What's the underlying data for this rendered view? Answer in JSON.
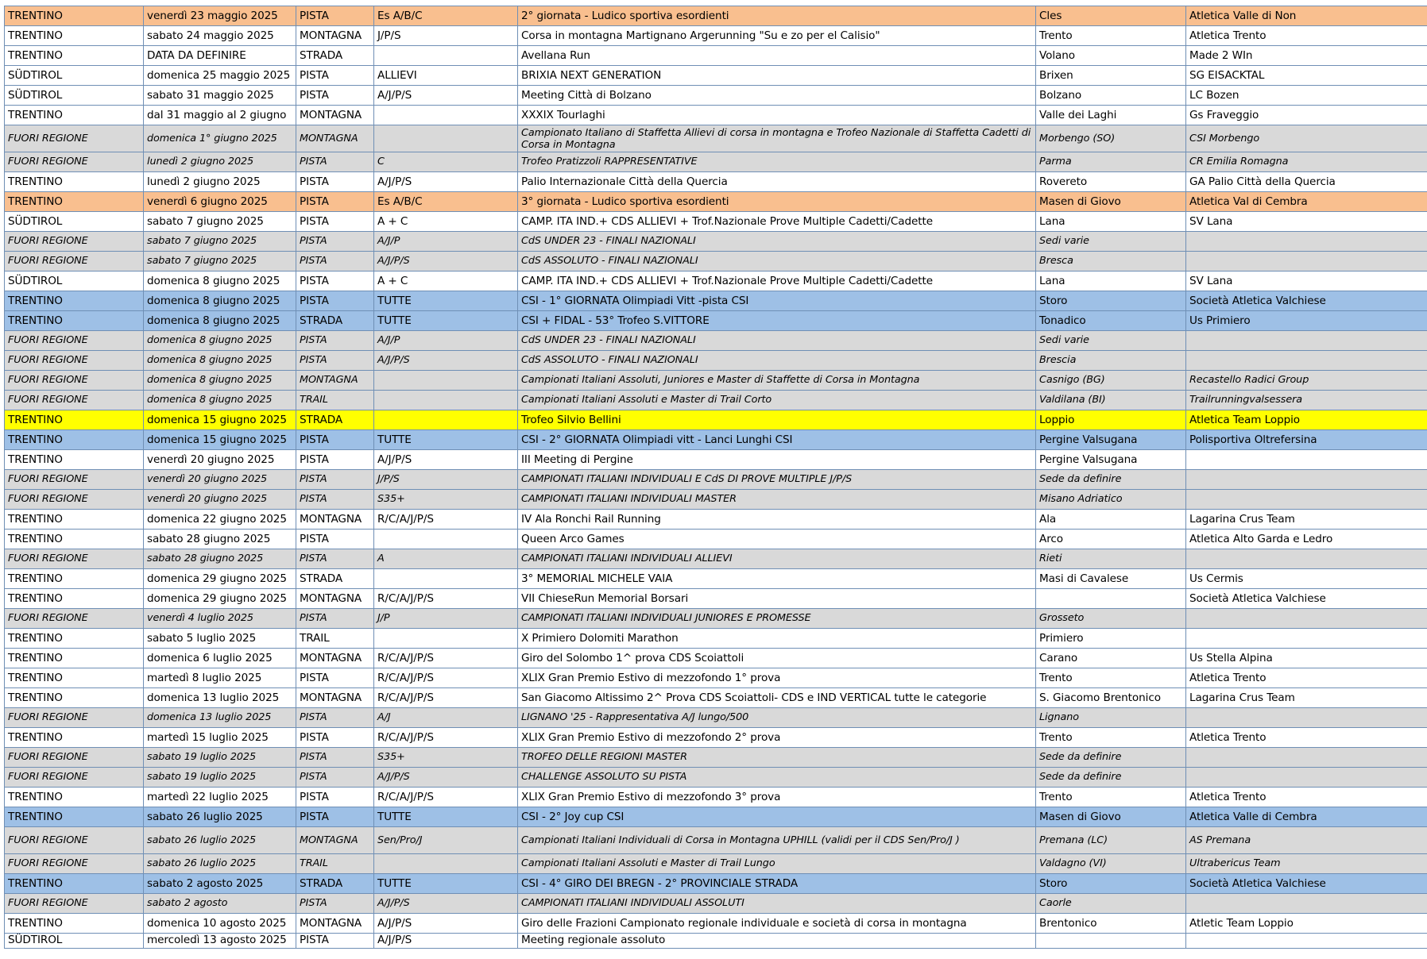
{
  "colors": {
    "orange": "#f9bf8f",
    "blue": "#9ec0e6",
    "yellow": "#ffff00",
    "gray": "#d9d9d9",
    "white": "#ffffff"
  },
  "rows": [
    {
      "style": "orange",
      "cells": [
        "TRENTINO",
        "venerdì 23 maggio 2025",
        "PISTA",
        "Es A/B/C",
        "2° giornata - Ludico sportiva esordienti",
        "Cles",
        "Atletica Valle di Non"
      ]
    },
    {
      "style": "white",
      "cells": [
        "TRENTINO",
        "sabato 24 maggio 2025",
        "MONTAGNA",
        "J/P/S",
        "Corsa in montagna Martignano Argerunning \"Su e zo per el Calisio\"",
        "Trento",
        "Atletica Trento"
      ]
    },
    {
      "style": "white",
      "cells": [
        "TRENTINO",
        "DATA DA DEFINIRE",
        "STRADA",
        "",
        "Avellana Run",
        "Volano",
        "Made 2 WIn"
      ]
    },
    {
      "style": "white",
      "cells": [
        "SÜDTIROL",
        "domenica 25 maggio 2025",
        "PISTA",
        "ALLIEVI",
        "BRIXIA NEXT GENERATION",
        "Brixen",
        "SG EISACKTAL"
      ]
    },
    {
      "style": "white",
      "cells": [
        "SÜDTIROL",
        "sabato 31 maggio 2025",
        "PISTA",
        "A/J/P/S",
        "Meeting Città di Bolzano",
        "Bolzano",
        "LC Bozen"
      ]
    },
    {
      "style": "white",
      "cells": [
        "TRENTINO",
        "dal 31 maggio al 2 giugno",
        "MONTAGNA",
        "",
        "XXXIX Tourlaghi",
        "Valle dei Laghi",
        "Gs Fraveggio"
      ]
    },
    {
      "style": "gray",
      "tall": true,
      "cells": [
        "FUORI REGIONE",
        "domenica 1° giugno 2025",
        "MONTAGNA",
        "",
        "Campionato Italiano di Staffetta Allievi di corsa in montagna e Trofeo Nazionale di Staffetta Cadetti di Corsa in Montagna",
        "Morbengo (SO)",
        "CSI Morbengo"
      ]
    },
    {
      "style": "gray",
      "cells": [
        "FUORI REGIONE",
        "lunedì 2 giugno 2025",
        "PISTA",
        "C",
        "Trofeo Pratizzoli RAPPRESENTATIVE",
        "Parma",
        "CR Emilia Romagna"
      ]
    },
    {
      "style": "white",
      "cells": [
        "TRENTINO",
        "lunedì 2 giugno 2025",
        "PISTA",
        "A/J/P/S",
        "Palio Internazionale Città della Quercia",
        "Rovereto",
        "GA Palio Città della Quercia"
      ]
    },
    {
      "style": "orange",
      "cells": [
        "TRENTINO",
        "venerdì 6 giugno 2025",
        "PISTA",
        "Es A/B/C",
        "3° giornata - Ludico sportiva esordienti",
        "Masen di Giovo",
        "Atletica Val di Cembra"
      ]
    },
    {
      "style": "white",
      "cells": [
        "SÜDTIROL",
        "sabato 7 giugno 2025",
        "PISTA",
        "A + C",
        "CAMP. ITA IND.+ CDS ALLIEVI + Trof.Nazionale Prove Multiple Cadetti/Cadette",
        "Lana",
        "SV Lana"
      ]
    },
    {
      "style": "gray",
      "cells": [
        "FUORI REGIONE",
        "sabato 7 giugno 2025",
        "PISTA",
        "A/J/P",
        "CdS UNDER 23 - FINALI NAZIONALI",
        "Sedi varie",
        ""
      ]
    },
    {
      "style": "gray",
      "cells": [
        "FUORI REGIONE",
        "sabato 7 giugno 2025",
        "PISTA",
        "A/J/P/S",
        "CdS ASSOLUTO - FINALI NAZIONALI",
        "Bresca",
        ""
      ]
    },
    {
      "style": "white",
      "cells": [
        "SÜDTIROL",
        "domenica 8 giugno 2025",
        "PISTA",
        "A + C",
        "CAMP. ITA IND.+ CDS ALLIEVI + Trof.Nazionale Prove Multiple Cadetti/Cadette",
        "Lana",
        "SV Lana"
      ]
    },
    {
      "style": "blue",
      "cells": [
        "TRENTINO",
        "domenica 8 giugno 2025",
        "PISTA",
        "TUTTE",
        "CSI - 1° GIORNATA Olimpiadi Vitt -pista CSI",
        "Storo",
        "Società Atletica Valchiese"
      ]
    },
    {
      "style": "blue",
      "cells": [
        "TRENTINO",
        "domenica 8 giugno 2025",
        "STRADA",
        "TUTTE",
        "CSI + FIDAL - 53° Trofeo S.VITTORE",
        "Tonadico",
        "Us Primiero"
      ]
    },
    {
      "style": "gray",
      "cells": [
        "FUORI REGIONE",
        "domenica 8 giugno 2025",
        "PISTA",
        "A/J/P",
        "CdS UNDER 23 - FINALI NAZIONALI",
        "Sedi varie",
        ""
      ]
    },
    {
      "style": "gray",
      "cells": [
        "FUORI REGIONE",
        "domenica 8 giugno 2025",
        "PISTA",
        "A/J/P/S",
        "CdS ASSOLUTO - FINALI NAZIONALI",
        "Brescia",
        ""
      ]
    },
    {
      "style": "gray",
      "cells": [
        "FUORI REGIONE",
        "domenica 8 giugno 2025",
        "MONTAGNA",
        "",
        "Campionati Italiani Assoluti, Juniores e Master di Staffette di Corsa in Montagna",
        "Casnigo (BG)",
        "Recastello Radici Group"
      ]
    },
    {
      "style": "gray",
      "cells": [
        "FUORI REGIONE",
        "domenica 8 giugno 2025",
        "TRAIL",
        "",
        "Campionati Italiani Assoluti e Master di Trail Corto",
        "Valdilana (BI)",
        "Trailrunningvalsessera"
      ]
    },
    {
      "style": "yellow",
      "cells": [
        "TRENTINO",
        "domenica 15 giugno 2025",
        "STRADA",
        "",
        "Trofeo Silvio Bellini",
        "Loppio",
        "Atletica Team Loppio"
      ]
    },
    {
      "style": "blue",
      "cells": [
        "TRENTINO",
        "domenica 15 giugno 2025",
        "PISTA",
        "TUTTE",
        "CSI - 2° GIORNATA Olimpiadi vitt - Lanci Lunghi CSI",
        "Pergine Valsugana",
        "Polisportiva Oltrefersina"
      ]
    },
    {
      "style": "white",
      "cells": [
        "TRENTINO",
        "venerdì 20 giugno 2025",
        "PISTA",
        "A/J/P/S",
        "III Meeting di Pergine",
        "Pergine Valsugana",
        ""
      ]
    },
    {
      "style": "gray",
      "cells": [
        "FUORI REGIONE",
        "venerdì 20 giugno 2025",
        "PISTA",
        "J/P/S",
        "CAMPIONATI ITALIANI INDIVIDUALI E CdS DI PROVE MULTIPLE J/P/S",
        "Sede da definire",
        ""
      ]
    },
    {
      "style": "gray",
      "cells": [
        "FUORI REGIONE",
        "venerdì 20 giugno 2025",
        "PISTA",
        "S35+",
        "CAMPIONATI ITALIANI INDIVIDUALI MASTER",
        "Misano Adriatico",
        ""
      ]
    },
    {
      "style": "white",
      "cells": [
        "TRENTINO",
        "domenica 22 giugno 2025",
        "MONTAGNA",
        "R/C/A/J/P/S",
        "IV Ala Ronchi Rail Running",
        "Ala",
        "Lagarina Crus Team"
      ]
    },
    {
      "style": "white",
      "cells": [
        "TRENTINO",
        "sabato 28 giugno 2025",
        "PISTA",
        "",
        "Queen Arco Games",
        "Arco",
        "Atletica Alto Garda e Ledro"
      ]
    },
    {
      "style": "gray",
      "cells": [
        "FUORI REGIONE",
        "sabato 28 giugno 2025",
        "PISTA",
        "A",
        "CAMPIONATI ITALIANI INDIVIDUALI ALLIEVI",
        "Rieti",
        ""
      ]
    },
    {
      "style": "white",
      "cells": [
        "TRENTINO",
        "domenica 29 giugno 2025",
        "STRADA",
        "",
        "3° MEMORIAL MICHELE VAIA",
        "Masi di Cavalese",
        "Us Cermis"
      ]
    },
    {
      "style": "white",
      "cells": [
        "TRENTINO",
        "domenica 29 giugno 2025",
        "MONTAGNA",
        "R/C/A/J/P/S",
        "VII ChieseRun Memorial Borsari",
        "",
        "Società Atletica Valchiese"
      ]
    },
    {
      "style": "gray",
      "cells": [
        "FUORI REGIONE",
        "venerdì 4 luglio 2025",
        "PISTA",
        "J/P",
        "CAMPIONATI ITALIANI INDIVIDUALI JUNIORES E PROMESSE",
        "Grosseto",
        ""
      ]
    },
    {
      "style": "white",
      "cells": [
        "TRENTINO",
        "sabato 5 luglio 2025",
        "TRAIL",
        "",
        "X Primiero Dolomiti Marathon",
        "Primiero",
        ""
      ]
    },
    {
      "style": "white",
      "cells": [
        "TRENTINO",
        "domenica 6 luglio 2025",
        "MONTAGNA",
        "R/C/A/J/P/S",
        "Giro del Solombo 1^ prova CDS Scoiattoli",
        "Carano",
        "Us Stella Alpina"
      ]
    },
    {
      "style": "white",
      "cells": [
        "TRENTINO",
        "martedì 8 luglio 2025",
        "PISTA",
        "R/C/A/J/P/S",
        "XLIX Gran Premio Estivo  di mezzofondo 1° prova",
        "Trento",
        "Atletica Trento"
      ]
    },
    {
      "style": "white",
      "cells": [
        "TRENTINO",
        "domenica 13 luglio 2025",
        "MONTAGNA",
        "R/C/A/J/P/S",
        "San Giacomo Altissimo 2^ Prova CDS Scoiattoli- CDS e IND VERTICAL tutte le categorie",
        "S. Giacomo Brentonico",
        "Lagarina Crus Team"
      ]
    },
    {
      "style": "gray",
      "cells": [
        "FUORI REGIONE",
        "domenica 13 luglio 2025",
        "PISTA",
        "A/J",
        "LIGNANO '25 - Rappresentativa A/J lungo/500",
        "Lignano",
        ""
      ]
    },
    {
      "style": "white",
      "cells": [
        "TRENTINO",
        "martedì 15 luglio 2025",
        "PISTA",
        "R/C/A/J/P/S",
        "XLIX Gran Premio Estivo  di mezzofondo 2° prova",
        "Trento",
        "Atletica Trento"
      ]
    },
    {
      "style": "gray",
      "cells": [
        "FUORI REGIONE",
        "sabato 19 luglio 2025",
        "PISTA",
        "S35+",
        "TROFEO DELLE REGIONI MASTER",
        "Sede da definire",
        ""
      ]
    },
    {
      "style": "gray",
      "cells": [
        "FUORI REGIONE",
        "sabato 19 luglio 2025",
        "PISTA",
        "A/J/P/S",
        "CHALLENGE ASSOLUTO SU PISTA",
        "Sede da definire",
        ""
      ]
    },
    {
      "style": "white",
      "cells": [
        "TRENTINO",
        "martedì 22 luglio 2025",
        "PISTA",
        "R/C/A/J/P/S",
        "XLIX Gran Premio Estivo  di mezzofondo 3° prova",
        "Trento",
        "Atletica Trento"
      ]
    },
    {
      "style": "blue",
      "cells": [
        "TRENTINO",
        "sabato 26 luglio 2025",
        "PISTA",
        "TUTTE",
        "CSI - 2° Joy cup CSI",
        "Masen di Giovo",
        "Atletica Valle di Cembra"
      ]
    },
    {
      "style": "gray",
      "tall": true,
      "cells": [
        "FUORI REGIONE",
        "sabato 26 luglio 2025",
        "MONTAGNA",
        "Sen/Pro/J",
        "Campionati Italiani Individuali di Corsa in Montagna UPHILL  (validi per il CDS Sen/Pro/J )",
        "Premana (LC)",
        "AS Premana"
      ]
    },
    {
      "style": "gray",
      "cells": [
        "FUORI REGIONE",
        "sabato 26 luglio 2025",
        "TRAIL",
        "",
        "Campionati Italiani Assoluti e Master di Trail Lungo",
        "Valdagno (VI)",
        "Ultrabericus Team"
      ]
    },
    {
      "style": "blue",
      "cells": [
        "TRENTINO",
        "sabato 2 agosto 2025",
        "STRADA",
        "TUTTE",
        "CSI - 4° GIRO DEI BREGN - 2° PROVINCIALE STRADA",
        "Storo",
        "Società Atletica Valchiese"
      ]
    },
    {
      "style": "gray",
      "cells": [
        "FUORI REGIONE",
        "sabato 2 agosto",
        "PISTA",
        "A/J/P/S",
        "CAMPIONATI ITALIANI INDIVIDUALI ASSOLUTI",
        "Caorle",
        ""
      ]
    },
    {
      "style": "white",
      "cells": [
        "TRENTINO",
        "domenica 10 agosto 2025",
        "MONTAGNA",
        "A/J/P/S",
        "Giro delle Frazioni Campionato regionale individuale e società di corsa in montagna",
        "Brentonico",
        "Atletic Team Loppio"
      ]
    },
    {
      "style": "white",
      "cut": true,
      "cells": [
        "SÜDTIROL",
        "mercoledì 13 agosto 2025",
        "PISTA",
        "A/J/P/S",
        "Meeting regionale assoluto",
        "",
        ""
      ]
    }
  ]
}
